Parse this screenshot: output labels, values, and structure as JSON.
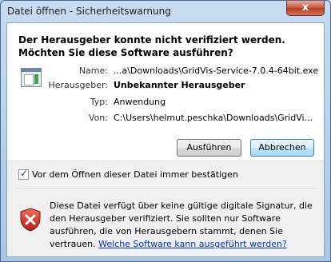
{
  "window": {
    "title": "Datei öffnen - Sicherheitswarnung",
    "close_label": "x"
  },
  "main": {
    "heading": "Der Herausgeber konnte nicht verifiziert werden. Möchten Sie diese Software ausführen?",
    "fields": [
      {
        "label": "Name:",
        "value": "...a\\Downloads\\GridVis-Service-7.0.4-64bit.exe"
      },
      {
        "label": "Herausgeber:",
        "value": "Unbekannter Herausgeber"
      },
      {
        "label": "Typ:",
        "value": "Anwendung"
      },
      {
        "label": "Von:",
        "value": "C:\\Users\\helmut.peschka\\Downloads\\GridVi..."
      }
    ]
  },
  "buttons": {
    "run": "Ausführen",
    "cancel": "Abbrechen"
  },
  "checkbox": {
    "label": "Vor dem Öffnen dieser Datei immer bestätigen",
    "checked": true
  },
  "warning": {
    "text": "Diese Datei verfügt über keine gültige digitale Signatur, die den Herausgeber verifiziert. Sie sollten nur Software ausführen, die von Herausgebern stammt, denen Sie vertrauen.",
    "link": "Welche Software kann ausgeführt werden?"
  },
  "colors": {
    "title_bar": "#b9d1ea",
    "close_button": "#c75a43",
    "shield": "#d32f2f",
    "link": "#0033cc"
  }
}
